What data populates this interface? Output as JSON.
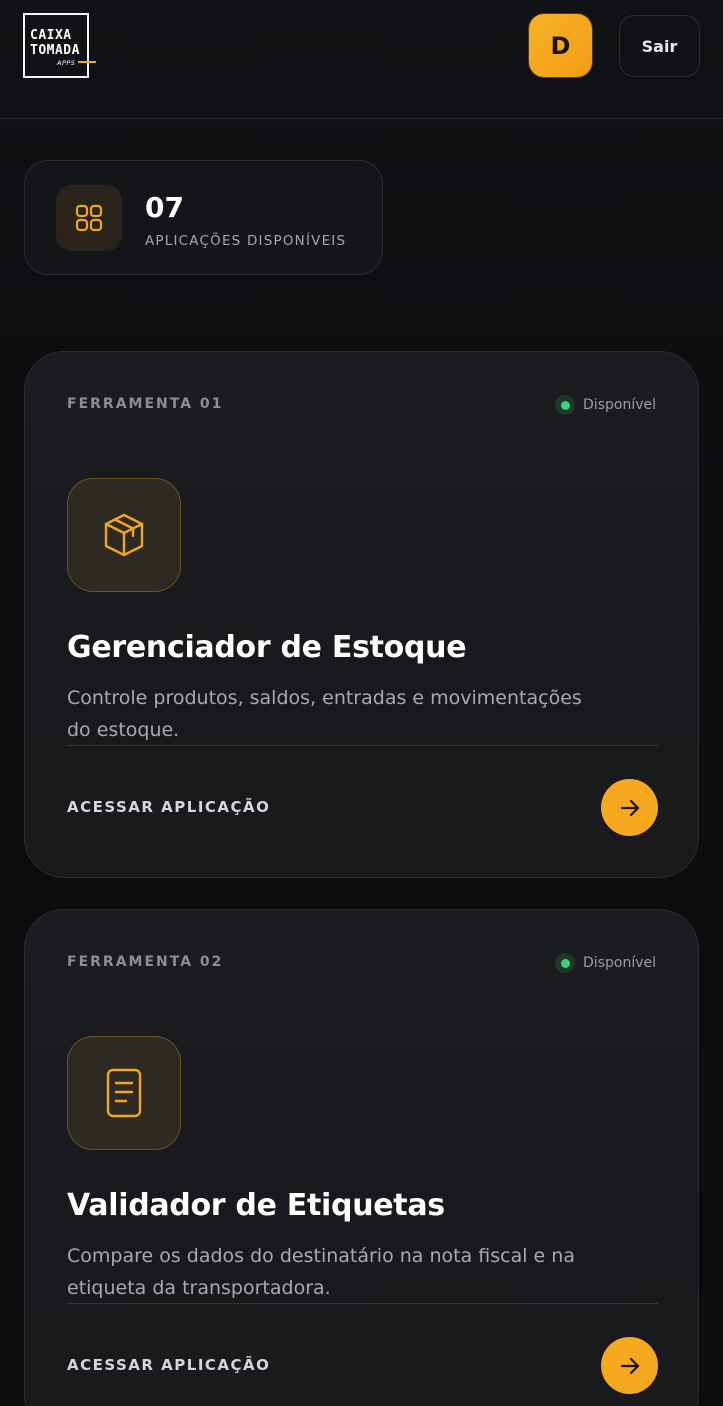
{
  "header": {
    "logo": {
      "line1": "CAIXA",
      "line2": "TOMADA",
      "sub": "APPS"
    },
    "avatar_initial": "D",
    "logout_label": "Sair"
  },
  "stats": {
    "count": "07",
    "label": "APLICAÇÕES DISPONÍVEIS",
    "icon": "grid-icon"
  },
  "tools": [
    {
      "tag": "FERRAMENTA 01",
      "status": "Disponível",
      "icon": "box-icon",
      "title": "Gerenciador de Estoque",
      "description": "Controle produtos, saldos, entradas e movimentações do estoque.",
      "cta": "ACESSAR APLICAÇÃO"
    },
    {
      "tag": "FERRAMENTA 02",
      "status": "Disponível",
      "icon": "document-icon",
      "title": "Validador de Etiquetas",
      "description": "Compare os dados do destinatário na nota fiscal e na etiqueta da transportadora.",
      "cta": "ACESSAR APLICAÇÃO"
    }
  ],
  "colors": {
    "accent": "#f6a91f",
    "status_green": "#3fd17a",
    "background": "#0c0d10",
    "card": "#1b1c20"
  }
}
